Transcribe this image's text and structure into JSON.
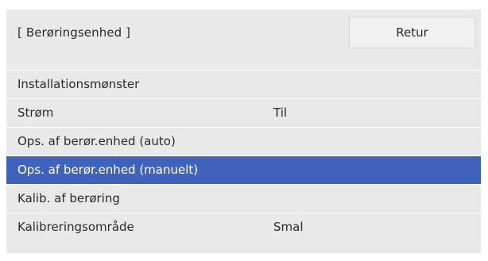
{
  "header": {
    "title": "[ Berøringsenhed ]",
    "return_label": "Retur"
  },
  "menu": {
    "items": [
      {
        "label": "Installationsmønster",
        "value": ""
      },
      {
        "label": "Strøm",
        "value": "Til"
      },
      {
        "label": "Ops. af berør.enhed (auto)",
        "value": ""
      },
      {
        "label": "Ops. af berør.enhed (manuelt)",
        "value": "",
        "selected": true
      },
      {
        "label": "Kalib. af berøring",
        "value": ""
      },
      {
        "label": "Kalibreringsområde",
        "value": "Smal"
      }
    ]
  },
  "colors": {
    "panel_background": "#e9e9e9",
    "selected_background": "#3f63bd",
    "selected_text": "#ffffff",
    "text": "#2b2b2b"
  }
}
